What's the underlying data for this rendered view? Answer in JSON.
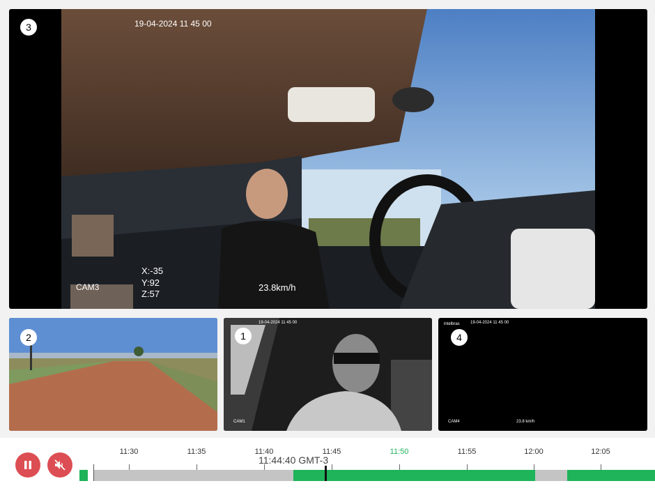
{
  "cameras": {
    "main": {
      "badge": "3",
      "timestamp": "19-04-2024  11 45 00",
      "cam_label": "CAM3",
      "gx": "X:-35",
      "gy": "Y:92",
      "gz": "Z:57",
      "speed": "23.8km/h"
    },
    "tile1": {
      "badge": "2"
    },
    "tile2": {
      "badge": "1",
      "timestamp": "19-04-2024  11 45 00",
      "cam_label": "CAM1"
    },
    "tile3": {
      "badge": "4",
      "brand": "intelbras",
      "timestamp": "19-04-2024  11 45 00",
      "cam_label": "CAM4",
      "speed": "23.8 km/h"
    }
  },
  "controls": {
    "pause_icon": "pause-icon",
    "mute_icon": "speaker-muted-icon"
  },
  "timeline": {
    "current_time": "11:44:40 GMT-3",
    "ticks": [
      "11:30",
      "11:35",
      "11:40",
      "11:45",
      "11:50",
      "11:55",
      "12:00",
      "12:05"
    ],
    "ticks_meta": [
      {
        "label": "11:30",
        "highlight": false
      },
      {
        "label": "11:35",
        "highlight": false
      },
      {
        "label": "11:40",
        "highlight": false
      },
      {
        "label": "11:45",
        "highlight": false
      },
      {
        "label": "11:50",
        "highlight": true
      },
      {
        "label": "11:55",
        "highlight": false
      },
      {
        "label": "12:00",
        "highlight": false
      },
      {
        "label": "12:05",
        "highlight": false
      }
    ],
    "colors": {
      "recorded": "#1fb35a",
      "gap": "#c4c4c4",
      "accent": "#dc4e53"
    }
  }
}
